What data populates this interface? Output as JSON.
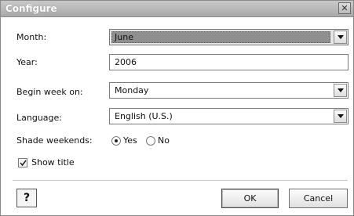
{
  "window": {
    "title": "Configure",
    "close_icon": "close-icon"
  },
  "month": {
    "label": "Month:",
    "value": "June"
  },
  "year": {
    "label": "Year:",
    "value": "2006"
  },
  "begin_week": {
    "label": "Begin week on:",
    "value": "Monday"
  },
  "language": {
    "label": "Language:",
    "value": "English (U.S.)"
  },
  "shade_weekends": {
    "label": "Shade weekends:",
    "options": [
      "Yes",
      "No"
    ],
    "selected": "Yes"
  },
  "show_title": {
    "label": "Show title",
    "checked": true
  },
  "buttons": {
    "help_icon": "help-icon",
    "ok": "OK",
    "cancel": "Cancel"
  }
}
